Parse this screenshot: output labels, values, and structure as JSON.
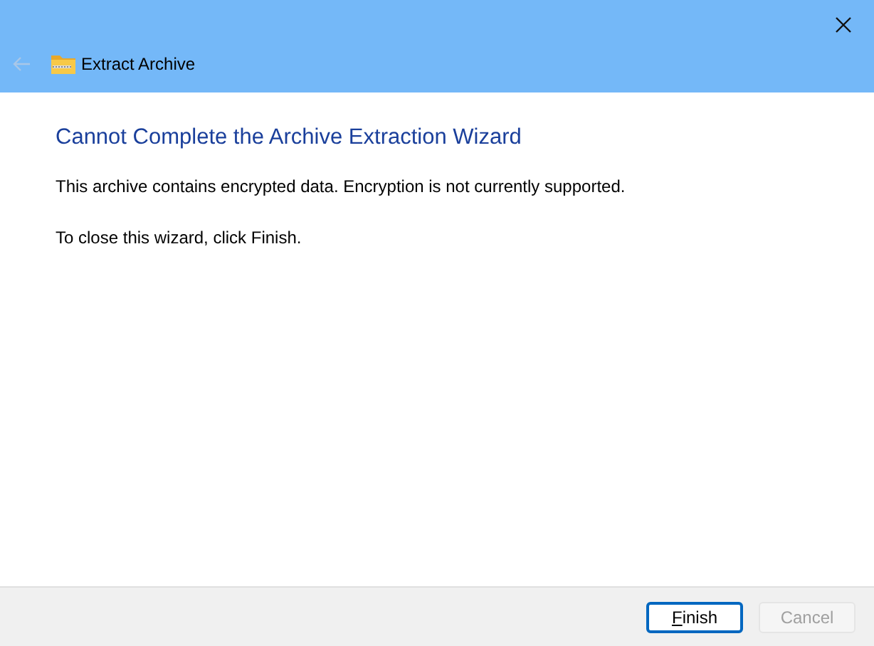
{
  "window": {
    "title": "Extract Archive",
    "back_disabled": true
  },
  "heading": "Cannot Complete the Archive Extraction Wizard",
  "paragraphs": [
    "This archive contains encrypted data. Encryption is not currently supported.",
    "To close this wizard, click Finish."
  ],
  "buttons": [
    {
      "label": "Finish",
      "disabled": false,
      "default": true,
      "mnemonic": true
    },
    {
      "label": "Cancel",
      "disabled": true,
      "default": false,
      "mnemonic": false
    }
  ]
}
